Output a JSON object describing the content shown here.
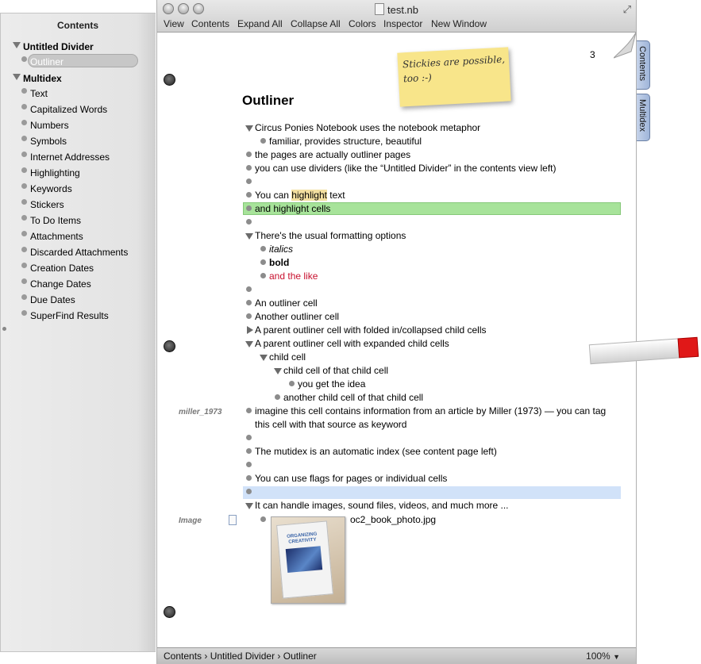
{
  "drawer": {
    "title": "Contents",
    "dividers": [
      {
        "label": "Untitled Divider",
        "pages": [
          "Outliner"
        ]
      },
      {
        "label": "Multidex",
        "pages": [
          "Text",
          "Capitalized Words",
          "Numbers",
          "Symbols",
          "Internet Addresses",
          "Highlighting",
          "Keywords",
          "Stickers",
          "To Do Items",
          "Attachments",
          "Discarded Attachments",
          "Creation Dates",
          "Change Dates",
          "Due Dates",
          "SuperFind Results"
        ]
      }
    ]
  },
  "window": {
    "title": "test.nb",
    "menu": [
      "View",
      "Contents",
      "Expand All",
      "Collapse All",
      "Colors",
      "Inspector",
      "New Window"
    ]
  },
  "page": {
    "number": "3",
    "title": "Outliner",
    "sticky": "Stickies are possible, too :-)",
    "rows": [
      {
        "t": "Circus Ponies Notebook uses the notebook metaphor"
      },
      {
        "t": "familiar, provides structure, beautiful"
      },
      {
        "t": "the pages are actually outliner pages"
      },
      {
        "t": "you can use dividers (like the “Untitled Divider” in the contents view left)"
      },
      {
        "t": ""
      },
      {
        "t_before": "You can ",
        "t_hl": "highlight",
        "t_after": " text"
      },
      {
        "t": "and highlight cells"
      },
      {
        "t": ""
      },
      {
        "t": "There's the usual formatting options"
      },
      {
        "t": "italics"
      },
      {
        "t": "bold"
      },
      {
        "t": "and the like"
      },
      {
        "t": ""
      },
      {
        "t": "An outliner cell"
      },
      {
        "t": "Another outliner cell"
      },
      {
        "t": "A parent outliner cell with folded in/collapsed child cells"
      },
      {
        "t": "A parent outliner cell with expanded child cells"
      },
      {
        "t": "child cell"
      },
      {
        "t": "child cell of that child cell"
      },
      {
        "t": "you get the idea"
      },
      {
        "t": "another child cell of that child cell"
      },
      {
        "t": "imagine this cell contains information from an article by Miller (1973) — you can tag"
      },
      {
        "t": "this cell with that source as keyword"
      },
      {
        "t": ""
      },
      {
        "t": "The mutidex is an automatic index (see content page left)"
      },
      {
        "t": ""
      },
      {
        "t": "You can use flags for pages or individual cells"
      },
      {
        "t": ""
      },
      {
        "t": "It can handle images, sound files, videos, and much more ..."
      },
      {
        "t": "oc2_book_photo.jpg"
      }
    ],
    "keywords": [
      "miller_1973",
      "Image"
    ],
    "photo_text": "ORGANIZING CREATIVITY"
  },
  "side_tabs": [
    "Contents",
    "Multidex"
  ],
  "status": {
    "crumbs": [
      "Contents",
      "Untitled Divider",
      "Outliner"
    ],
    "zoom": "100%"
  },
  "colors": {
    "cell_highlight": "#a7e39a",
    "text_highlight": "#f3dfa0",
    "flagged_cell": "#d1e2f9",
    "red_text": "#c8102e",
    "sticky": "#f8e58a"
  }
}
